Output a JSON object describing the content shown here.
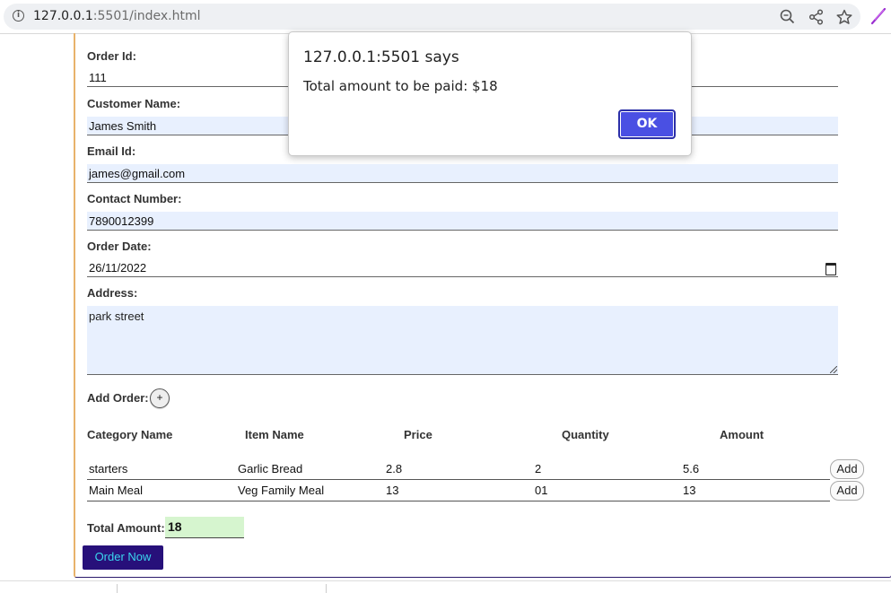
{
  "browser": {
    "url_host": "127.0.0.1",
    "url_rest": ":5501/index.html"
  },
  "form": {
    "order_id": {
      "label": "Order Id:",
      "value": "111"
    },
    "customer_name": {
      "label": "Customer Name:",
      "value": "James Smith"
    },
    "email": {
      "label": "Email Id:",
      "value": "james@gmail.com"
    },
    "contact": {
      "label": "Contact Number:",
      "value": "7890012399"
    },
    "order_date": {
      "label": "Order Date:",
      "value": "26/11/2022"
    },
    "address": {
      "label": "Address:",
      "value": "park street"
    },
    "add_order_label": "Add Order:",
    "plus_label": "+"
  },
  "table": {
    "headers": [
      "Category Name",
      "Item Name",
      "Price",
      "Quantity",
      "Amount"
    ],
    "rows": [
      {
        "category": "starters",
        "item": "Garlic Bread",
        "price": "2.8",
        "quantity": "2",
        "amount": "5.6",
        "button": "Add"
      },
      {
        "category": "Main Meal",
        "item": "Veg Family Meal",
        "price": "13",
        "quantity": "01",
        "amount": "13",
        "button": "Add"
      }
    ]
  },
  "total": {
    "label": "Total Amount:",
    "value": "18"
  },
  "order_button": "Order Now",
  "dialog": {
    "title": "127.0.0.1:5501 says",
    "message": "Total amount to be paid: $18",
    "ok": "OK"
  },
  "colors": {
    "autofill": "#e8f0fe",
    "total_bg": "#d6f5cf",
    "order_button_bg": "#27107a",
    "order_button_text": "#3ad6ee",
    "dialog_ok": "#4a50e3"
  }
}
